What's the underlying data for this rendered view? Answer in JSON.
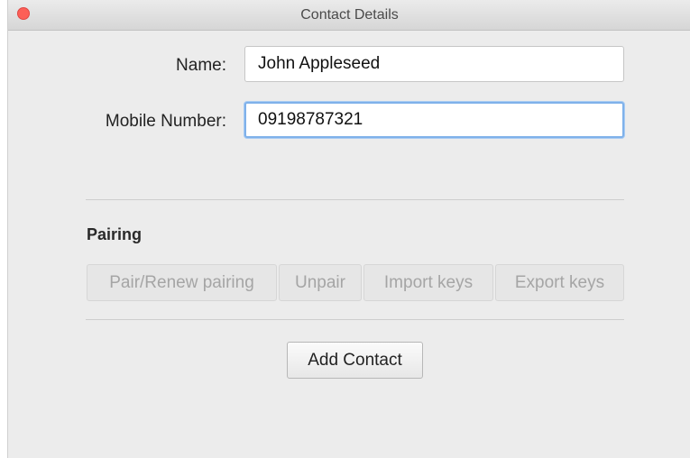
{
  "window": {
    "title": "Contact Details"
  },
  "form": {
    "name_label": "Name:",
    "name_value": "John Appleseed",
    "mobile_label": "Mobile Number:",
    "mobile_value": "09198787321"
  },
  "pairing": {
    "section_title": "Pairing",
    "buttons": {
      "pair": "Pair/Renew pairing",
      "unpair": "Unpair",
      "import": "Import keys",
      "export": "Export keys"
    }
  },
  "actions": {
    "add_contact": "Add Contact"
  },
  "colors": {
    "close_button": "#fc5f57",
    "focus_ring": "#7fb1ea"
  }
}
